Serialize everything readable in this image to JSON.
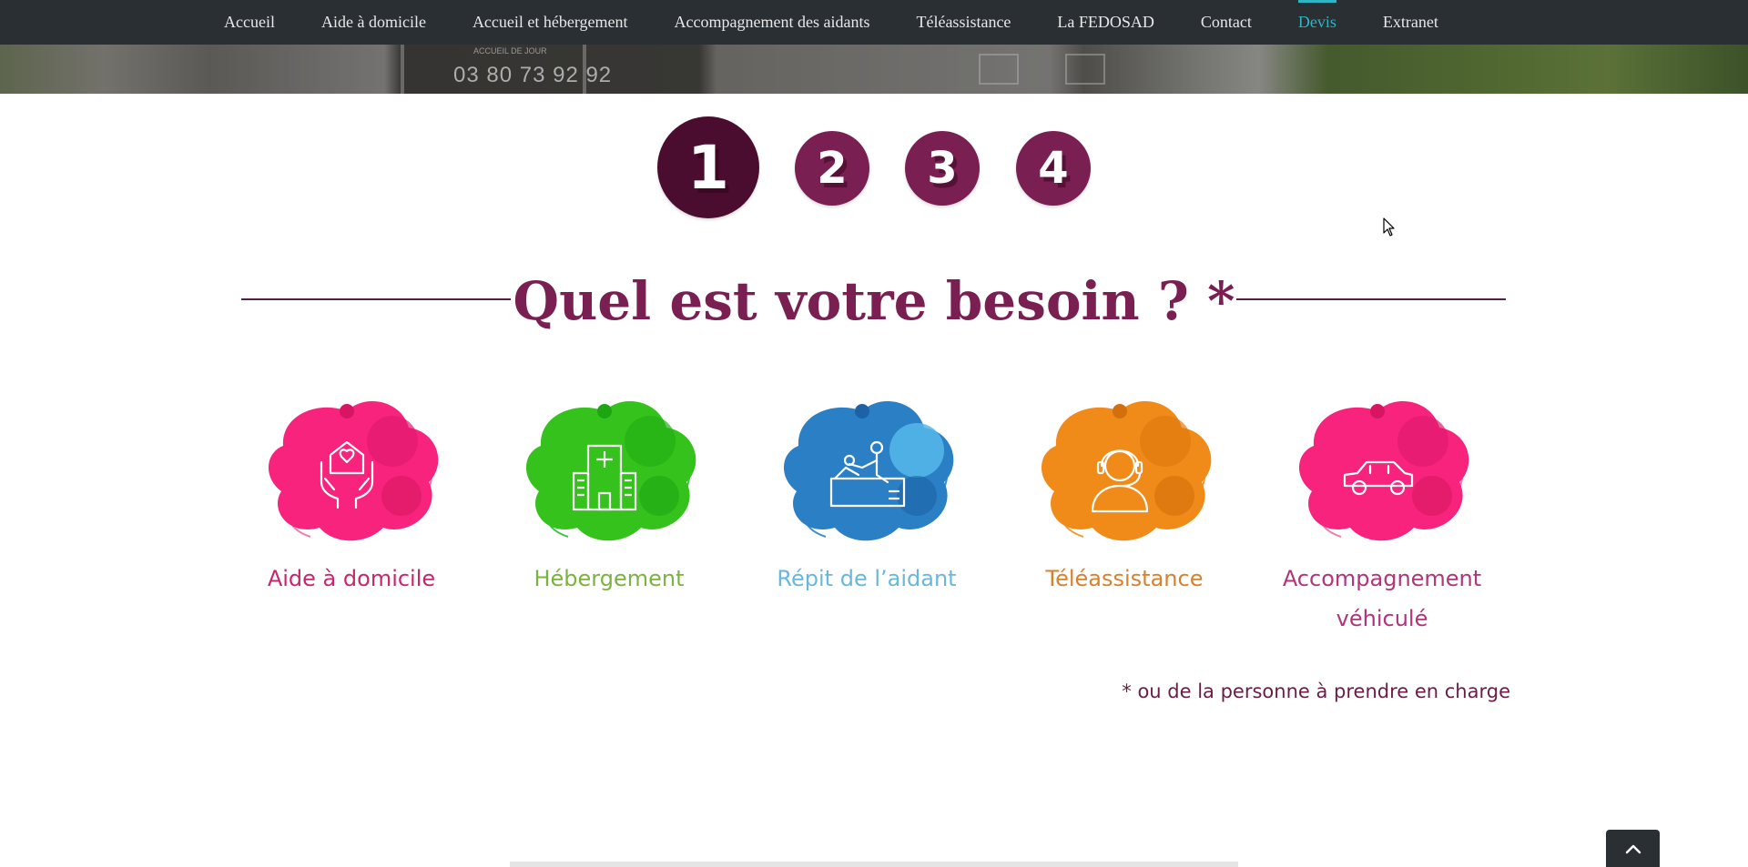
{
  "nav": {
    "items": [
      {
        "label": "Accueil",
        "active": false
      },
      {
        "label": "Aide à domicile",
        "active": false
      },
      {
        "label": "Accueil et hébergement",
        "active": false
      },
      {
        "label": "Accompagnement des aidants",
        "active": false
      },
      {
        "label": "Téléassistance",
        "active": false
      },
      {
        "label": "La FEDOSAD",
        "active": false
      },
      {
        "label": "Contact",
        "active": false
      },
      {
        "label": "Devis",
        "active": true
      },
      {
        "label": "Extranet",
        "active": false
      }
    ]
  },
  "hero": {
    "phone": "03 80 73 92 92",
    "sign_text": "ACCUEIL DE JOUR"
  },
  "steps": [
    {
      "label": "1",
      "current": true
    },
    {
      "label": "2",
      "current": false
    },
    {
      "label": "3",
      "current": false
    },
    {
      "label": "4",
      "current": false
    }
  ],
  "heading": "Quel est votre besoin ? *",
  "needs": [
    {
      "label": "Aide à domicile",
      "icon": "home-care-icon",
      "color": "#c8276f",
      "text_color": "#c8276f"
    },
    {
      "label": "Hébergement",
      "icon": "hospital-building-icon",
      "color": "#2bb51e",
      "text_color": "#7ab340"
    },
    {
      "label": "Répit de l’aidant",
      "icon": "caregiver-respite-icon",
      "color": "#2a7ec6",
      "text_color": "#6ab7dc"
    },
    {
      "label": "Téléassistance",
      "icon": "operator-headset-icon",
      "color": "#ef8418",
      "text_color": "#d9802e"
    },
    {
      "label": "Accompagnement véhiculé",
      "icon": "car-icon",
      "color": "#f1247a",
      "text_color": "#b0357b"
    }
  ],
  "note": "* ou de la personne à prendre en charge",
  "colors": {
    "nav_bg": "#2a2f33",
    "nav_active": "#2eb6c7",
    "brand": "#7a1f52"
  }
}
